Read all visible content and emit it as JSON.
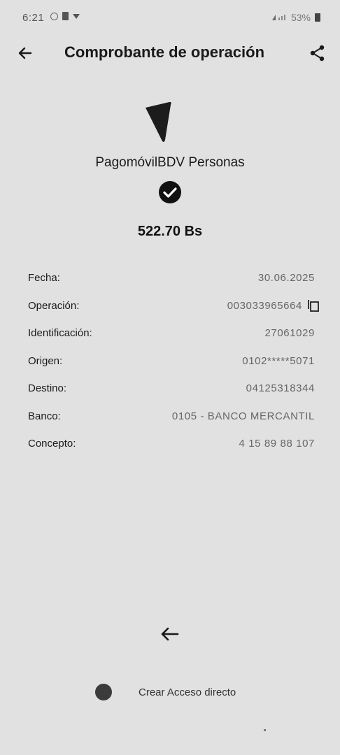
{
  "status_bar": {
    "time": "6:21",
    "battery": "53%"
  },
  "header": {
    "title": "Comprobante de operación"
  },
  "receipt": {
    "service": "PagomóvilBDV Personas",
    "amount": "522.70 Bs",
    "details": [
      {
        "label": "Fecha:",
        "value": "30.06.2025"
      },
      {
        "label": "Operación:",
        "value": "003033965664"
      },
      {
        "label": "Identificación:",
        "value": "27061029"
      },
      {
        "label": "Origen:",
        "value": "0102*****5071"
      },
      {
        "label": "Destino:",
        "value": "04125318344"
      },
      {
        "label": "Banco:",
        "value": "0105 - BANCO MERCANTIL"
      },
      {
        "label": "Concepto:",
        "value": "4 15 89 88 107"
      }
    ]
  },
  "footer": {
    "shortcut_label": "Crear Acceso directo"
  }
}
